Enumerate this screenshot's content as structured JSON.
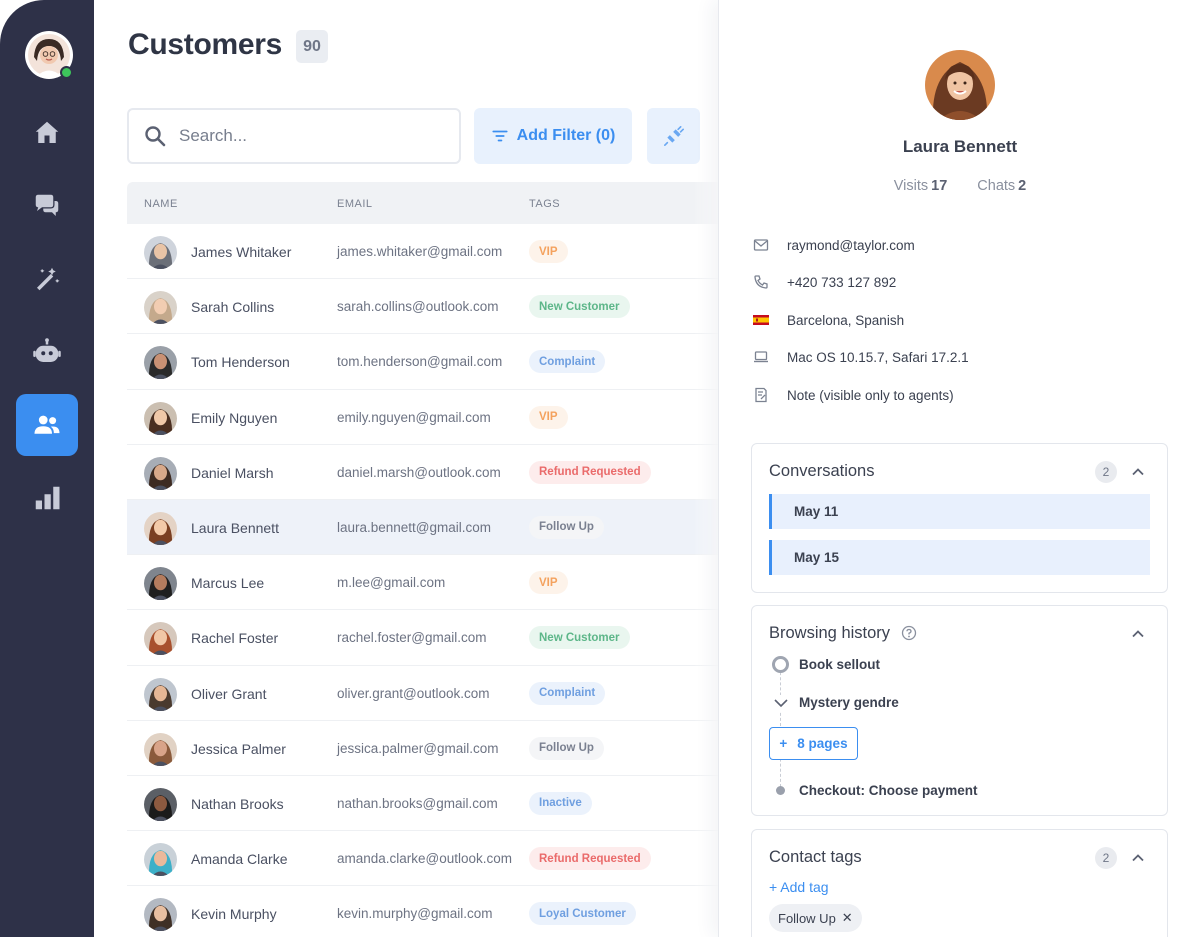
{
  "colors": {
    "accent": "#3b8ef0",
    "sidebar": "#2e3148",
    "online": "#3dc45b"
  },
  "sidebar": {
    "items": [
      {
        "name": "home",
        "icon": "home-icon",
        "active": false
      },
      {
        "name": "chats",
        "icon": "chat-bubbles-icon",
        "active": false
      },
      {
        "name": "magic",
        "icon": "magic-wand-icon",
        "active": false
      },
      {
        "name": "bot",
        "icon": "bot-icon",
        "active": false
      },
      {
        "name": "customers",
        "icon": "users-icon",
        "active": true
      },
      {
        "name": "analytics",
        "icon": "bar-chart-icon",
        "active": false
      }
    ]
  },
  "main": {
    "title": "Customers",
    "count": "90",
    "search_placeholder": "Search...",
    "add_filter_label": "Add Filter (0)",
    "columns": [
      "NAME",
      "EMAIL",
      "TAGS"
    ],
    "rows": [
      {
        "name": "James Whitaker",
        "email": "james.whitaker@gmail.com",
        "tag": "VIP",
        "tag_color": "#f4a25e",
        "tag_bg": "#fdf3ea",
        "selected": false
      },
      {
        "name": "Sarah Collins",
        "email": "sarah.collins@outlook.com",
        "tag": "New Customer",
        "tag_color": "#5db689",
        "tag_bg": "#e9f6ef",
        "selected": false
      },
      {
        "name": "Tom Henderson",
        "email": "tom.henderson@gmail.com",
        "tag": "Complaint",
        "tag_color": "#6f9fe0",
        "tag_bg": "#ebf2fc",
        "selected": false
      },
      {
        "name": "Emily Nguyen",
        "email": "emily.nguyen@gmail.com",
        "tag": "VIP",
        "tag_color": "#f4a25e",
        "tag_bg": "#fdf3ea",
        "selected": false
      },
      {
        "name": "Daniel Marsh",
        "email": "daniel.marsh@outlook.com",
        "tag": "Refund Requested",
        "tag_color": "#ea6b6b",
        "tag_bg": "#fdecec",
        "selected": false
      },
      {
        "name": "Laura Bennett",
        "email": "laura.bennett@gmail.com",
        "tag": "Follow Up",
        "tag_color": "#7a8090",
        "tag_bg": "#f4f5f7",
        "selected": true
      },
      {
        "name": "Marcus Lee",
        "email": "m.lee@gmail.com",
        "tag": "VIP",
        "tag_color": "#f4a25e",
        "tag_bg": "#fdf3ea",
        "selected": false
      },
      {
        "name": "Rachel Foster",
        "email": "rachel.foster@gmail.com",
        "tag": "New Customer",
        "tag_color": "#5db689",
        "tag_bg": "#e9f6ef",
        "selected": false
      },
      {
        "name": "Oliver Grant",
        "email": "oliver.grant@outlook.com",
        "tag": "Complaint",
        "tag_color": "#6f9fe0",
        "tag_bg": "#ebf2fc",
        "selected": false
      },
      {
        "name": "Jessica Palmer",
        "email": "jessica.palmer@gmail.com",
        "tag": "Follow Up",
        "tag_color": "#7a8090",
        "tag_bg": "#f4f5f7",
        "selected": false
      },
      {
        "name": "Nathan Brooks",
        "email": "nathan.brooks@gmail.com",
        "tag": "Inactive",
        "tag_color": "#6f9fe0",
        "tag_bg": "#ebf2fc",
        "selected": false
      },
      {
        "name": "Amanda Clarke",
        "email": "amanda.clarke@outlook.com",
        "tag": "Refund Requested",
        "tag_color": "#ea6b6b",
        "tag_bg": "#fdecec",
        "selected": false
      },
      {
        "name": "Kevin Murphy",
        "email": "kevin.murphy@gmail.com",
        "tag": "Loyal Customer",
        "tag_color": "#6f9fe0",
        "tag_bg": "#ebf2fc",
        "selected": false
      }
    ]
  },
  "profile": {
    "name": "Laura Bennett",
    "visits_label": "Visits",
    "visits": "17",
    "chats_label": "Chats",
    "chats": "2",
    "email": "raymond@taylor.com",
    "phone": "+420 733 127 892",
    "location": "Barcelona, Spanish",
    "device": "Mac OS 10.15.7, Safari 17.2.1",
    "note": "Note (visible only to agents)"
  },
  "conversations": {
    "title": "Conversations",
    "count": "2",
    "items": [
      "May 11",
      "May 15"
    ]
  },
  "browsing": {
    "title": "Browsing history",
    "first": "Book sellout",
    "second": "Mystery gendre",
    "pages_label": "8 pages",
    "last": "Checkout: Choose payment"
  },
  "contact_tags": {
    "title": "Contact tags",
    "count": "2",
    "add_label": "+ Add tag",
    "tags": [
      "Follow Up"
    ]
  }
}
